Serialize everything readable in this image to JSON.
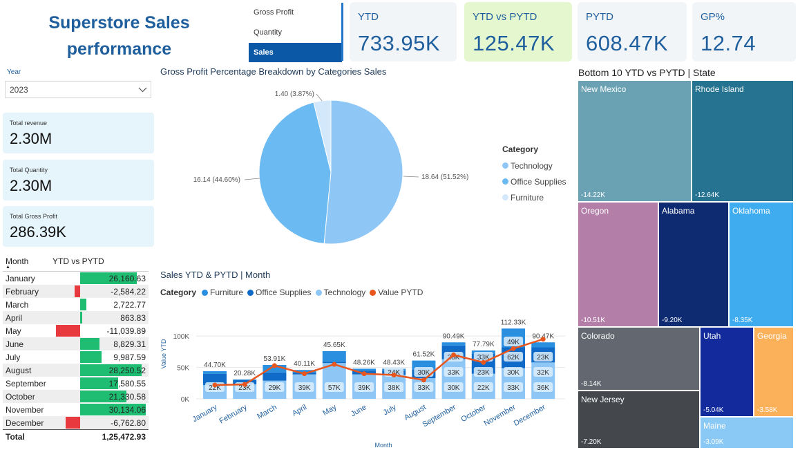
{
  "header": {
    "title_line1": "Superstore Sales",
    "title_line2": "performance"
  },
  "measure_slicer": {
    "items": [
      "Gross Profit",
      "Quantity",
      "Sales"
    ],
    "selected": "Sales"
  },
  "kpis": [
    {
      "label": "YTD",
      "value": "733.95K"
    },
    {
      "label": "YTD vs PYTD",
      "value": "125.47K"
    },
    {
      "label": "PYTD",
      "value": "608.47K"
    },
    {
      "label": "GP%",
      "value": "12.74"
    }
  ],
  "year_filter": {
    "label": "Year",
    "value": "2023"
  },
  "cards": [
    {
      "label": "Total revenue",
      "value": "2.30M"
    },
    {
      "label": "Total Quantity",
      "value": "2.30M"
    },
    {
      "label": "Total Gross Profit",
      "value": "286.39K"
    }
  ],
  "month_table": {
    "col_month": "Month",
    "col_value": "YTD vs PYTD",
    "rows": [
      {
        "month": "January",
        "value": "26,160.63",
        "num": 26160.63
      },
      {
        "month": "February",
        "value": "-2,584.22",
        "num": -2584.22
      },
      {
        "month": "March",
        "value": "2,722.77",
        "num": 2722.77
      },
      {
        "month": "April",
        "value": "863.83",
        "num": 863.83
      },
      {
        "month": "May",
        "value": "-11,039.89",
        "num": -11039.89
      },
      {
        "month": "June",
        "value": "8,829.31",
        "num": 8829.31
      },
      {
        "month": "July",
        "value": "9,987.59",
        "num": 9987.59
      },
      {
        "month": "August",
        "value": "28,250.52",
        "num": 28250.52
      },
      {
        "month": "September",
        "value": "17,580.55",
        "num": 17580.55
      },
      {
        "month": "October",
        "value": "21,330.58",
        "num": 21330.58
      },
      {
        "month": "November",
        "value": "30,134.06",
        "num": 30134.06
      },
      {
        "month": "December",
        "value": "-6,762.80",
        "num": -6762.8
      }
    ],
    "total_label": "Total",
    "total_value": "1,25,472.93",
    "pos_color": "#1fbd72",
    "neg_color": "#e8393f"
  },
  "chart_data": [
    {
      "type": "pie",
      "title": "Gross Profit Percentage Breakdown by Categories Sales",
      "legend_title": "Category",
      "legend_position": "right",
      "slices": [
        {
          "name": "Technology",
          "value": 18.64,
          "label": "18.64 (51.52%)",
          "color": "#8ec6f5"
        },
        {
          "name": "Office Supplies",
          "value": 16.14,
          "label": "16.14 (44.60%)",
          "color": "#6cbaf2"
        },
        {
          "name": "Furniture",
          "value": 1.4,
          "label": "1.40 (3.87%)",
          "color": "#d3e9fb"
        }
      ]
    },
    {
      "type": "bar",
      "stacked": true,
      "title": "Sales YTD & PYTD | Month",
      "legend_title": "Category",
      "legend_position": "top-left",
      "xlabel": "Month",
      "ylabel": "Value YTD",
      "ylim": [
        0,
        120000
      ],
      "yticks": [
        "0K",
        "50K",
        "100K"
      ],
      "categories": [
        "January",
        "February",
        "March",
        "April",
        "May",
        "June",
        "July",
        "August",
        "September",
        "October",
        "November",
        "December"
      ],
      "totals": [
        "44.70K",
        "20.28K",
        "53.91K",
        "40.11K",
        "45.65K",
        "48.26K",
        "48.43K",
        "61.52K",
        "90.49K",
        "77.79K",
        "112.33K",
        "90.47K"
      ],
      "series": [
        {
          "name": "Furniture",
          "color": "#2b8fe0",
          "values": [
            4,
            1,
            12,
            4,
            17,
            3,
            3,
            14,
            5,
            5,
            30,
            8
          ]
        },
        {
          "name": "Office Supplies",
          "color": "#0f6bc7",
          "values": [
            18,
            7,
            13,
            3,
            2,
            6,
            7,
            14,
            22,
            32,
            33,
            24
          ]
        },
        {
          "name": "Technology",
          "color": "#8ec6f5",
          "values": [
            22,
            23,
            29,
            39,
            57,
            39,
            38,
            33,
            63,
            40,
            49,
            58
          ]
        },
        {
          "name": "Value PYTD",
          "color": "#e8561e",
          "type": "line",
          "values": [
            22,
            23,
            53,
            40,
            55,
            40,
            38,
            30,
            70,
            58,
            80,
            95
          ]
        }
      ],
      "segment_labels": [
        [
          "22K",
          "",
          ""
        ],
        [
          "23K",
          "",
          ""
        ],
        [
          "29K",
          "",
          ""
        ],
        [
          "39K",
          "",
          ""
        ],
        [
          "57K",
          "",
          ""
        ],
        [
          "39K",
          "",
          ""
        ],
        [
          "38K",
          "24K",
          ""
        ],
        [
          "33K",
          "30K",
          ""
        ],
        [
          "30K",
          "33K",
          "28K"
        ],
        [
          "22K",
          "23K",
          "33K"
        ],
        [
          "33K",
          "30K",
          "62K",
          "49K"
        ],
        [
          "36K",
          "32K",
          "23K"
        ]
      ]
    }
  ],
  "treemap": {
    "title": "Bottom 10 YTD vs PYTD | State",
    "cells": [
      {
        "name": "New Mexico",
        "value": "-14.22K",
        "color": "#6ba2b3"
      },
      {
        "name": "Rhode Island",
        "value": "-12.64K",
        "color": "#257390"
      },
      {
        "name": "Oregon",
        "value": "-10.51K",
        "color": "#b37fa8"
      },
      {
        "name": "Alabama",
        "value": "-9.20K",
        "color": "#0e2a70"
      },
      {
        "name": "Oklahoma",
        "value": "-8.35K",
        "color": "#3eacef"
      },
      {
        "name": "Colorado",
        "value": "-8.14K",
        "color": "#636870"
      },
      {
        "name": "Utah",
        "value": "-5.04K",
        "color": "#122a9b"
      },
      {
        "name": "Georgia",
        "value": "-3.58K",
        "color": "#fbb15a"
      },
      {
        "name": "New Jersey",
        "value": "-7.20K",
        "color": "#44484d"
      },
      {
        "name": "Maine",
        "value": "-3.09K",
        "color": "#8ac9f5"
      }
    ]
  }
}
